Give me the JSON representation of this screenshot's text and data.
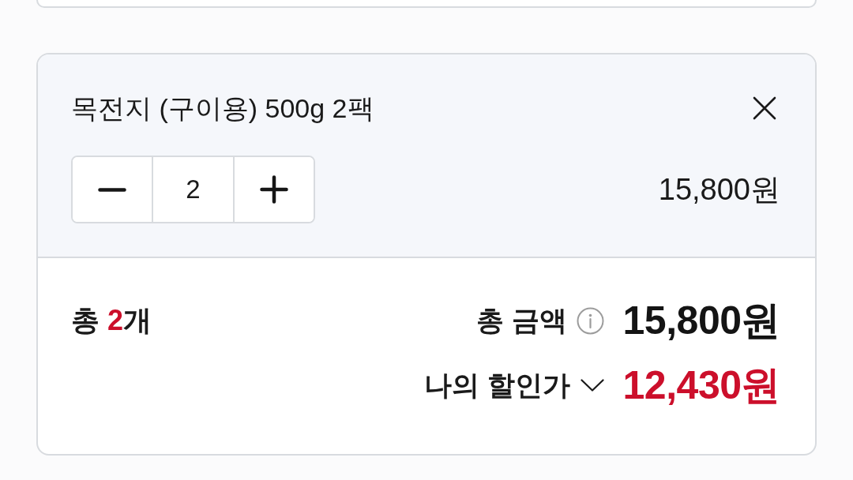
{
  "item": {
    "title": "목전지 (구이용) 500g 2팩",
    "quantity": "2",
    "price": "15,800원"
  },
  "summary": {
    "count": {
      "prefix": "총 ",
      "value": "2",
      "suffix": "개"
    },
    "total_label": "총 금액",
    "total": "15,800원",
    "discount_label": "나의 할인가",
    "discount_expanded": false,
    "discount_price": "12,430원"
  }
}
